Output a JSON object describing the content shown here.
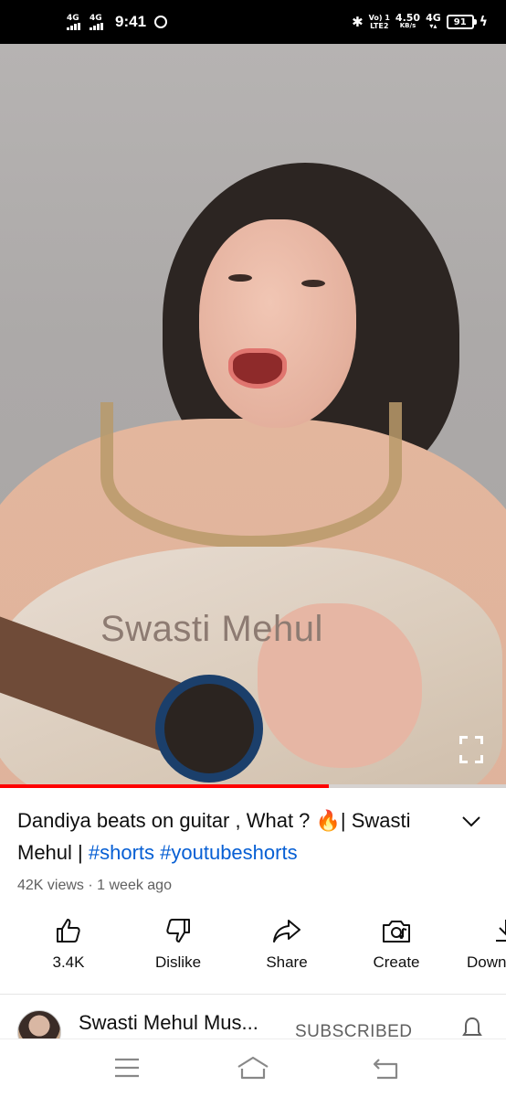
{
  "status_bar": {
    "network_1": "4G",
    "network_2": "4G",
    "time": "9:41",
    "volte_top": "Vo) 1",
    "volte_bottom": "LTE2",
    "speed_value": "4.50",
    "speed_unit": "KB/s",
    "network_3": "4G",
    "battery": "91",
    "icons": [
      "signal-icon",
      "whatsapp-icon",
      "bluetooth-icon",
      "battery-icon",
      "charging-icon"
    ]
  },
  "video": {
    "watermark": "Swasti Mehul",
    "progress_fraction": 0.65,
    "progress_color": "#ff0000",
    "fullscreen_icon": "fullscreen-icon"
  },
  "info": {
    "title_text": "Dandiya beats on guitar , What ? 🔥| Swasti Mehul | ",
    "hashtags": [
      "#shorts",
      "#youtubeshorts"
    ],
    "link_color": "#065fd4",
    "meta": "42K views · 1 week ago"
  },
  "actions": [
    {
      "icon": "thumbs-up-icon",
      "label": "3.4K"
    },
    {
      "icon": "thumbs-down-icon",
      "label": "Dislike"
    },
    {
      "icon": "share-icon",
      "label": "Share"
    },
    {
      "icon": "create-icon",
      "label": "Create"
    },
    {
      "icon": "download-icon",
      "label": "Downl"
    }
  ],
  "channel": {
    "name": "Swasti Mehul Mus...",
    "subscribe_state": "SUBSCRIBED"
  },
  "nav_bar": {
    "icons": [
      "menu-icon",
      "home-icon",
      "back-icon"
    ]
  }
}
